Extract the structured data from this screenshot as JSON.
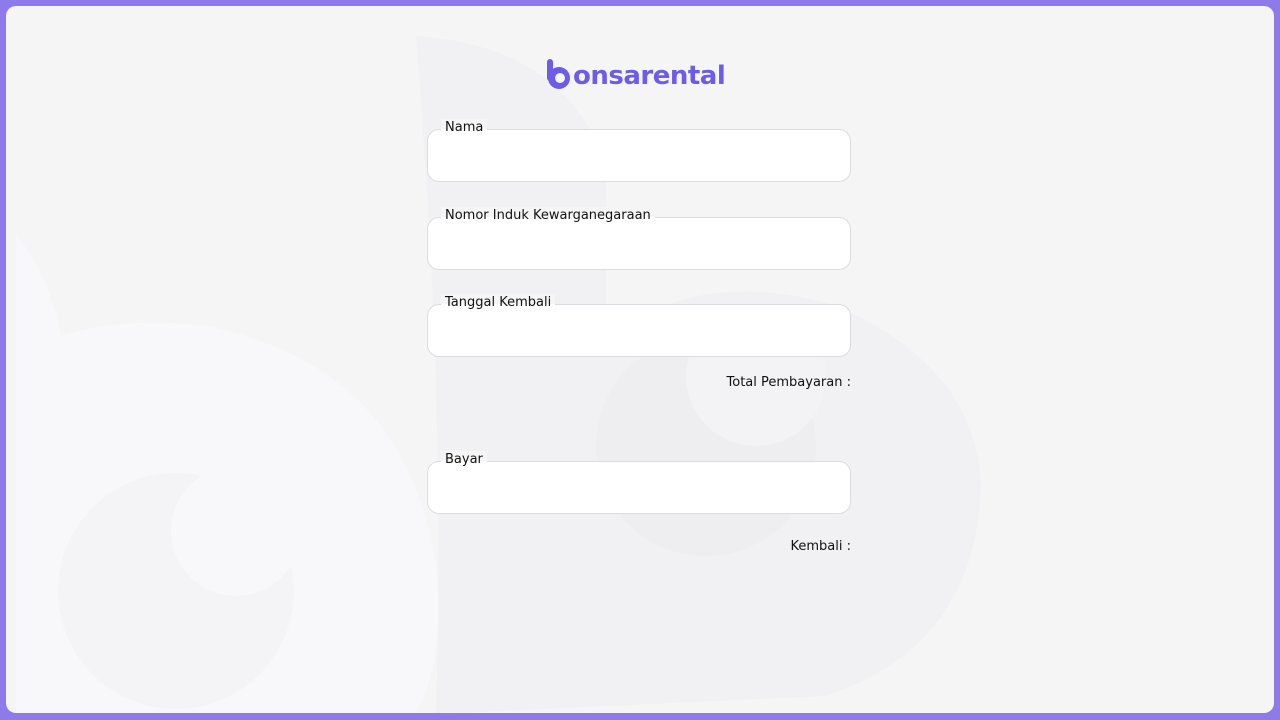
{
  "brand": {
    "logo_text": "onsarental",
    "color": "#6c5ce7"
  },
  "form": {
    "nama": {
      "label": "Nama",
      "value": ""
    },
    "nik": {
      "label": "Nomor Induk Kewarganegaraan",
      "value": ""
    },
    "tanggal_kembali": {
      "label": "Tanggal Kembali",
      "value": ""
    },
    "total_pembayaran": {
      "label": "Total Pembayaran :"
    },
    "bayar": {
      "label": "Bayar",
      "value": ""
    },
    "kembali": {
      "label": "Kembali :"
    }
  },
  "colors": {
    "outer_border": "#8e7ae8",
    "background": "#f5f5f6",
    "field_border": "#dcdce0"
  }
}
